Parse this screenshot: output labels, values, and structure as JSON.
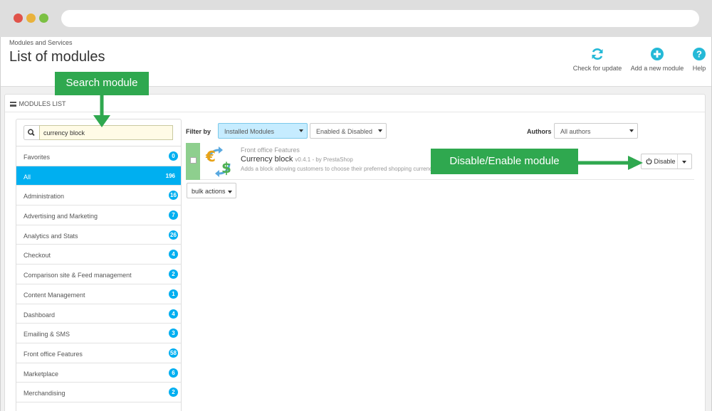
{
  "window": {
    "dot_colors": [
      "#e0534a",
      "#e9b23c",
      "#7bc043"
    ]
  },
  "header": {
    "breadcrumb": "Modules and Services",
    "title": "List of modules",
    "toolbar": [
      {
        "label": "Check for update",
        "icon": "refresh-icon"
      },
      {
        "label": "Add a new module",
        "icon": "plus-circle-icon"
      },
      {
        "label": "Help",
        "icon": "help-icon"
      }
    ]
  },
  "panel": {
    "heading": "MODULES LIST"
  },
  "search": {
    "value": "currency block",
    "icon": "search-icon"
  },
  "categories": [
    {
      "label": "Favorites",
      "count": "0"
    },
    {
      "label": "All",
      "count": "196",
      "active": true
    },
    {
      "label": "Administration",
      "count": "16"
    },
    {
      "label": "Advertising and Marketing",
      "count": "7"
    },
    {
      "label": "Analytics and Stats",
      "count": "26"
    },
    {
      "label": "Checkout",
      "count": "4"
    },
    {
      "label": "Comparison site & Feed management",
      "count": "2"
    },
    {
      "label": "Content Management",
      "count": "1"
    },
    {
      "label": "Dashboard",
      "count": "4"
    },
    {
      "label": "Emailing & SMS",
      "count": "3"
    },
    {
      "label": "Front office Features",
      "count": "58"
    },
    {
      "label": "Marketplace",
      "count": "6"
    },
    {
      "label": "Merchandising",
      "count": "2"
    }
  ],
  "filters": {
    "filter_by_label": "Filter by",
    "installed": "Installed Modules",
    "status": "Enabled & Disabled",
    "authors_label": "Authors",
    "authors": "All authors"
  },
  "module": {
    "category": "Front office Features",
    "name": "Currency block",
    "meta": "v0.4.1 - by PrestaShop",
    "description": "Adds a block allowing customers to choose their preferred shopping currency.",
    "action": "Disable"
  },
  "bulk_actions": "bulk actions",
  "callouts": {
    "search": "Search module",
    "disable": "Disable/Enable module"
  },
  "colors": {
    "accent": "#00aff0",
    "callout": "#2fa84f",
    "module_stripe": "#8ecf8e"
  }
}
